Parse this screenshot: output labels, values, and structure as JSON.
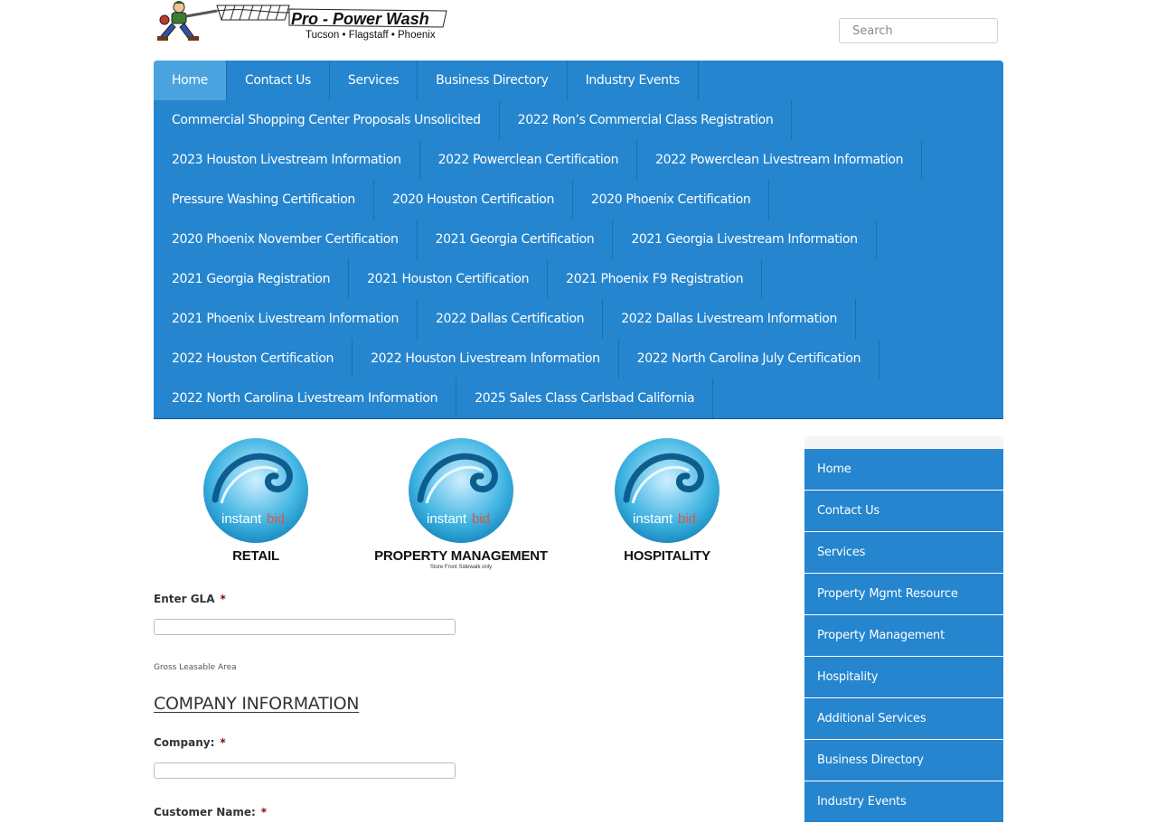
{
  "header": {
    "logo": {
      "title": "Pro - Power Wash",
      "subtitle": "Tucson • Flagstaff • Phoenix"
    },
    "search": {
      "placeholder": "Search",
      "value": ""
    }
  },
  "topnav": {
    "rows": [
      [
        "Home",
        "Contact Us",
        "Services",
        "Business Directory",
        "Industry Events"
      ],
      [
        "Commercial Shopping Center Proposals Unsolicited",
        "2022 Ron’s Commercial Class Registration"
      ],
      [
        "2023 Houston Livestream Information",
        "2022 Powerclean Certification",
        "2022 Powerclean Livestream Information"
      ],
      [
        "Pressure Washing Certification",
        "2020 Houston Certification",
        "2020 Phoenix Certification"
      ],
      [
        "2020 Phoenix November Certification",
        "2021 Georgia Certification",
        "2021 Georgia Livestream Information"
      ],
      [
        "2021 Georgia Registration",
        "2021 Houston Certification",
        "2021 Phoenix F9 Registration"
      ],
      [
        "2021 Phoenix Livestream Information",
        "2022 Dallas Certification",
        "2022 Dallas Livestream Information"
      ],
      [
        "2022 Houston Certification",
        "2022 Houston Livestream Information",
        "2022 North Carolina July Certification"
      ],
      [
        "2022 North Carolina Livestream Information",
        "2025 Sales Class Carlsbad California"
      ]
    ],
    "active": "Home"
  },
  "badges": [
    {
      "brand_a": "instant",
      "brand_b": "bid",
      "label": "RETAIL",
      "sub": ""
    },
    {
      "brand_a": "instant",
      "brand_b": "bid",
      "label": "PROPERTY MANAGEMENT",
      "sub": "Store Front Sidewalk only"
    },
    {
      "brand_a": "instant",
      "brand_b": "bid",
      "label": "HOSPITALITY",
      "sub": ""
    }
  ],
  "form": {
    "gla_label": "Enter GLA",
    "required_mark": "*",
    "gla_value": "",
    "gla_help": "Gross Leasable Area",
    "section_title": "COMPANY INFORMATION",
    "company_label": "Company:",
    "company_value": "",
    "customer_name_label": "Customer Name:"
  },
  "sidebar": {
    "items": [
      "Home",
      "Contact Us",
      "Services",
      "Property Mgmt Resource",
      "Property Management",
      "Hospitality",
      "Additional Services",
      "Business Directory",
      "Industry Events"
    ]
  },
  "colors": {
    "nav_blue": "#2585cf",
    "nav_active": "#4aa3df",
    "required": "#8b0000",
    "badge_circle": "#33b6e0",
    "brand_red": "#e2553f"
  }
}
